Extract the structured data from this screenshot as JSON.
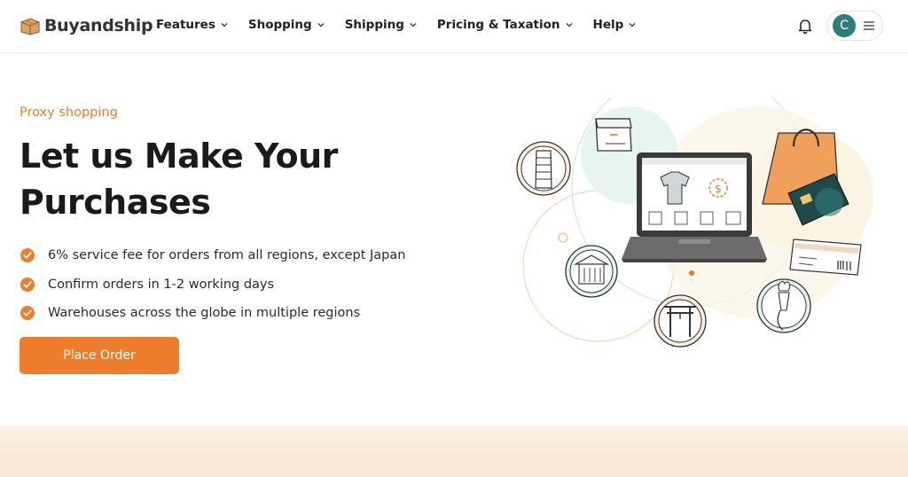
{
  "header": {
    "logo_text": "Buyandship",
    "nav": [
      {
        "label": "Features"
      },
      {
        "label": "Shopping"
      },
      {
        "label": "Shipping"
      },
      {
        "label": "Pricing & Taxation"
      },
      {
        "label": "Help"
      }
    ],
    "avatar_initial": "C"
  },
  "hero": {
    "eyebrow": "Proxy shopping",
    "title": "Let us Make Your Purchases",
    "features": [
      "6% service fee for orders from all regions, except Japan",
      "Confirm orders in 1-2 working days",
      "Warehouses across the globe in multiple regions"
    ],
    "cta_label": "Place Order"
  },
  "colors": {
    "accent": "#ee7d2b",
    "avatar_bg": "#2f7d7a",
    "band": "#fbf1e3"
  },
  "icons": [
    "box-logo-icon",
    "chevron-down-icon",
    "bell-icon",
    "hamburger-menu-icon",
    "check-circle-icon"
  ]
}
